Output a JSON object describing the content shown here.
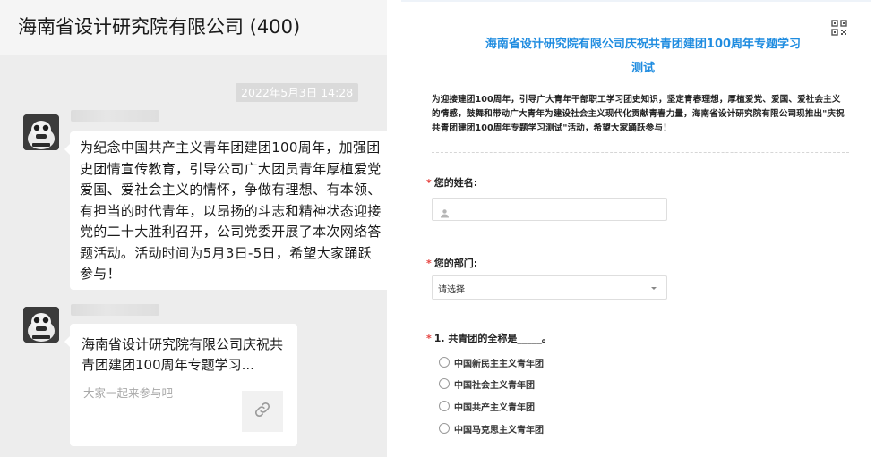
{
  "chat": {
    "title": "海南省设计研究院有限公司 (400)",
    "timestamp": "2022年5月3日 14:28",
    "message1": "为纪念中国共产主义青年团建团100周年，加强团史团情宣传教育，引导公司广大团员青年厚植爱党爱国、爱社会主义的情怀，争做有理想、有本领、有担当的时代青年，以昂扬的斗志和精神状态迎接党的二十大胜利召开，公司党委开展了本次网络答题活动。活动时间为5月3日-5日，希望大家踊跃参与！",
    "link_card": {
      "title": "海南省设计研究院有限公司庆祝共青团建团100周年专题学习...",
      "description": "大家一起来参与吧",
      "icon": "link-icon"
    }
  },
  "form": {
    "title_line1": "海南省设计研究院有限公司庆祝共青团建团100周年专题学习",
    "title_line2": "测试",
    "intro": "为迎接建团100周年，引导广大青年干部职工学习团史知识，坚定青春理想，厚植爱党、爱国、爱社会主义的情感，鼓舞和带动广大青年为建设社会主义现代化贡献青春力量，海南省设计研究院有限公司现推出\"庆祝共青团建团100周年专题学习测试\"活动，希望大家踊跃参与！",
    "required_mark": "*",
    "name_label": "您的姓名:",
    "dept_label": "您的部门:",
    "dept_value": "请选择",
    "question1": {
      "label": "1. 共青团的全称是_____。",
      "options": [
        "中国新民主主义青年团",
        "中国社会主义青年团",
        "中国共产主义青年团",
        "中国马克思主义青年团"
      ]
    },
    "colors": {
      "accent": "#1f8ce0",
      "required": "#e64340"
    }
  }
}
